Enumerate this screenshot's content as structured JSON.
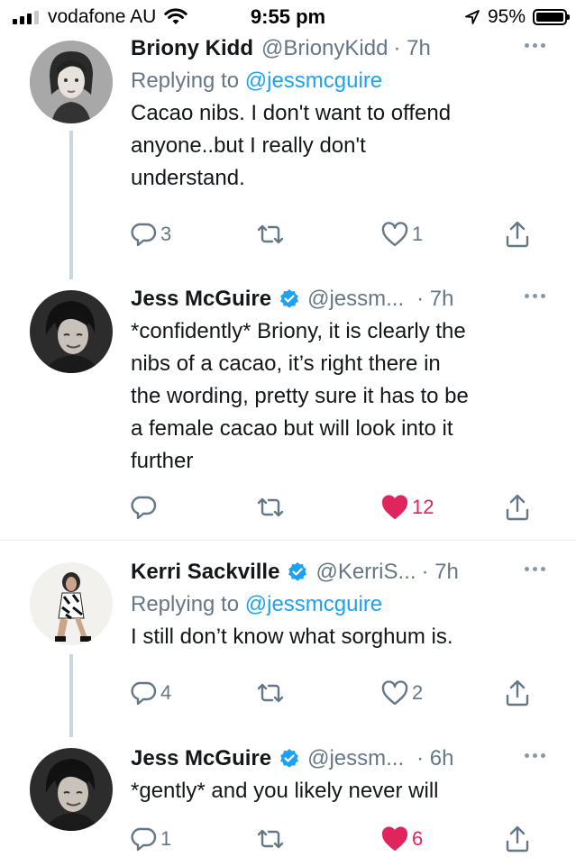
{
  "status_bar": {
    "carrier": "vodafone AU",
    "time": "9:55 pm",
    "battery": "95%",
    "signal_bars": 3
  },
  "tweets": [
    {
      "name": "Briony Kidd",
      "handle": "@BrionyKidd",
      "time": "· 7h",
      "verified": false,
      "reply_prefix": "Replying to ",
      "reply_mention": "@jessmcguire",
      "lines": [
        "Cacao nibs. I don't want to offend",
        "anyone..but I really don't",
        "understand."
      ],
      "replies": "3",
      "likes": "1",
      "liked": false
    },
    {
      "name": "Jess McGuire",
      "handle": "@jessm...",
      "time": "· 7h",
      "verified": true,
      "lines": [
        "*confidently* Briony, it is clearly the",
        "nibs of a cacao, it’s right there in",
        "the wording, pretty sure it has to be",
        "a female cacao but will look into it",
        "further"
      ],
      "replies": "",
      "likes": "12",
      "liked": true
    },
    {
      "name": "Kerri Sackville",
      "handle": "@KerriS...",
      "time": "· 7h",
      "verified": true,
      "reply_prefix": "Replying to ",
      "reply_mention": "@jessmcguire",
      "lines": [
        "I still don’t know what sorghum is."
      ],
      "replies": "4",
      "likes": "2",
      "liked": false
    },
    {
      "name": "Jess McGuire",
      "handle": "@jessm...",
      "time": "· 6h",
      "verified": true,
      "lines": [
        "*gently* and you likely never will"
      ],
      "replies": "1",
      "likes": "6",
      "liked": true
    }
  ],
  "colors": {
    "text": "#14171a",
    "secondary": "#657786",
    "link": "#1da1f2",
    "like": "#e0245e",
    "thread_line": "#ccd6dd"
  },
  "icons": [
    "reply-icon",
    "retweet-icon",
    "like-icon",
    "share-icon",
    "verified-badge-icon",
    "more-icon"
  ]
}
